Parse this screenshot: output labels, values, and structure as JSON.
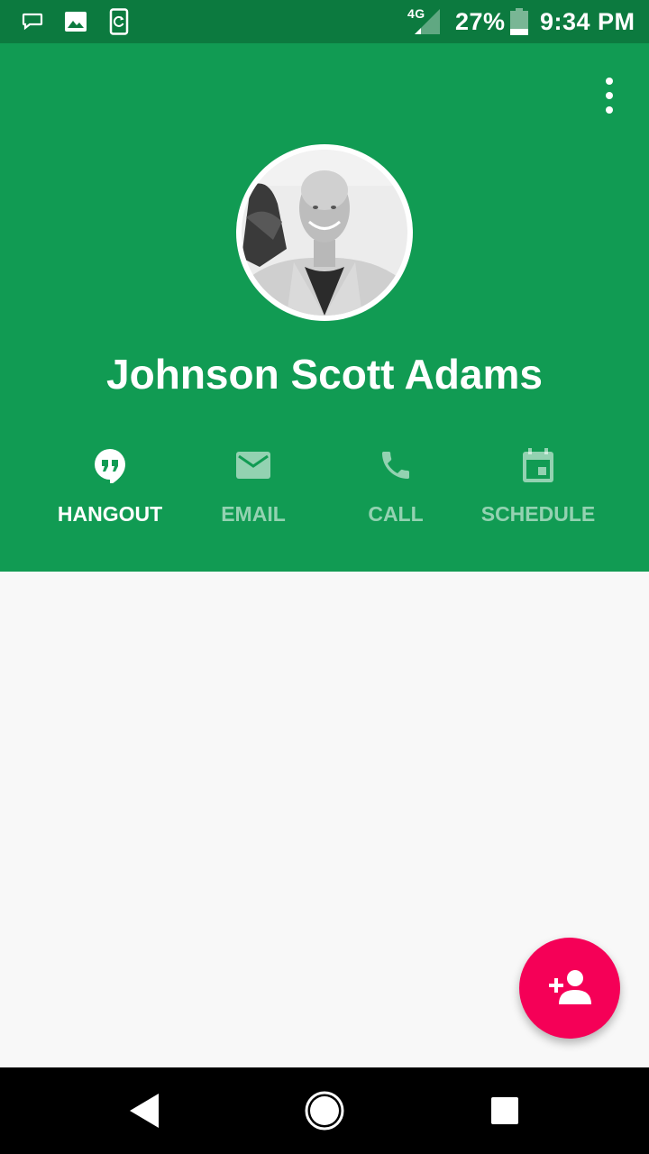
{
  "status_bar": {
    "network_type": "4G",
    "battery_percent": "27%",
    "time": "9:34 PM",
    "signal_strength": 0.25,
    "battery_level": 0.27,
    "icons": [
      "message-icon",
      "image-icon",
      "sync-icon",
      "signal-icon",
      "battery-icon"
    ]
  },
  "contact": {
    "name": "Johnson Scott Adams"
  },
  "actions": [
    {
      "label": "HANGOUT",
      "icon": "hangouts-icon",
      "active": true
    },
    {
      "label": "EMAIL",
      "icon": "email-icon",
      "active": false
    },
    {
      "label": "CALL",
      "icon": "phone-icon",
      "active": false
    },
    {
      "label": "SCHEDULE",
      "icon": "calendar-icon",
      "active": false
    }
  ],
  "fab": {
    "icon": "add-person-icon"
  },
  "colors": {
    "status_bar": "#0c7a3f",
    "header": "#119b53",
    "fab": "#f50057",
    "content_bg": "#f8f8f8",
    "nav_bar": "#000000"
  },
  "navigation": {
    "icons": [
      "back-icon",
      "home-icon",
      "recents-icon"
    ]
  }
}
